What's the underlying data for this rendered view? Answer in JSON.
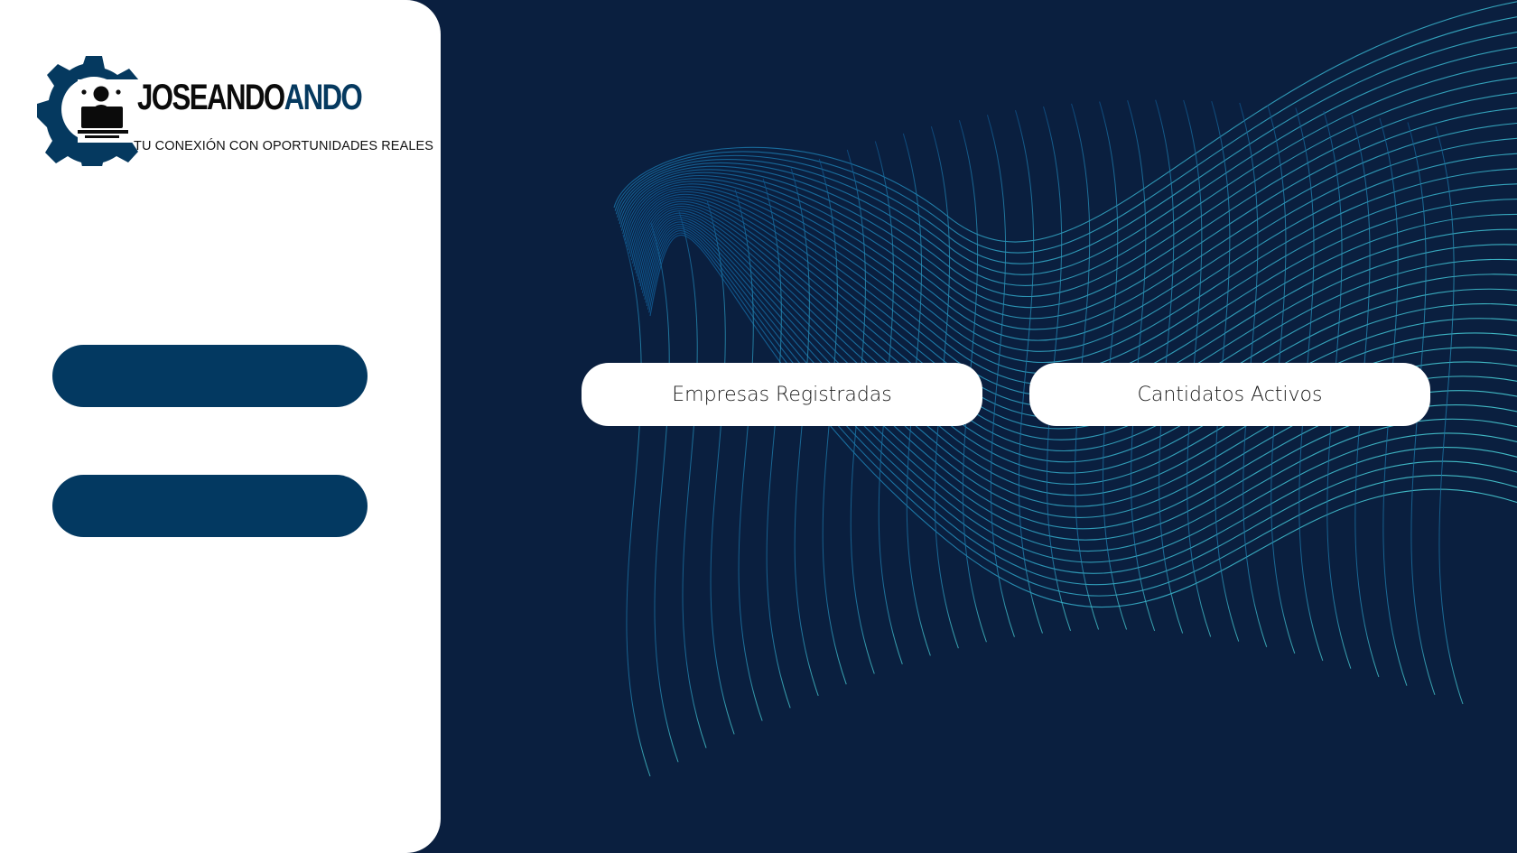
{
  "brand": {
    "name_part1": "JOSEANDO",
    "name_part2": "ANDO",
    "tagline": "TU CONEXIÓN CON OPORTUNIDADES REALES",
    "accent_color": "#05395f"
  },
  "colors": {
    "background": "#0a1f3f",
    "sidebar": "#ffffff",
    "sidebar_button": "#033961",
    "wave_start": "#0e5a8c",
    "wave_end": "#3fb7c6"
  },
  "sidebar": {
    "buttons": [
      {
        "label": "",
        "icon": "none"
      },
      {
        "label": "",
        "icon": "none"
      }
    ]
  },
  "main": {
    "cards": [
      {
        "label": "Empresas Registradas"
      },
      {
        "label": "Cantidatos Activos"
      }
    ]
  }
}
